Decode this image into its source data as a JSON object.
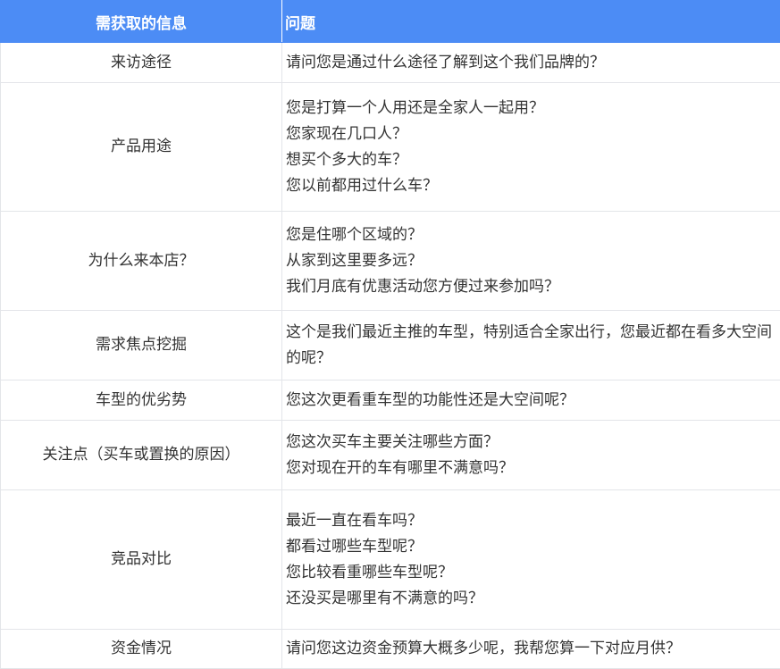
{
  "header": {
    "col1": "需获取的信息",
    "col2": "问题"
  },
  "rows": [
    {
      "info": "来访途径",
      "questions": [
        "请问您是通过什么途径了解到这个我们品牌的？"
      ]
    },
    {
      "info": "产品用途",
      "questions": [
        "您是打算一个人用还是全家人一起用？",
        "您家现在几口人？",
        "想买个多大的车？",
        "您以前都用过什么车？"
      ]
    },
    {
      "info": "为什么来本店？",
      "questions": [
        "您是住哪个区域的？",
        "从家到这里要多远？",
        "我们月底有优惠活动您方便过来参加吗？"
      ]
    },
    {
      "info": "需求焦点挖掘",
      "questions": [
        "这个是我们最近主推的车型，特别适合全家出行，您最近都在看多大空间的呢？"
      ]
    },
    {
      "info": "车型的优劣势",
      "questions": [
        "您这次更看重车型的功能性还是大空间呢？"
      ]
    },
    {
      "info": "关注点（买车或置换的原因）",
      "questions": [
        "您这次买车主要关注哪些方面？",
        "您对现在开的车有哪里不满意吗？"
      ]
    },
    {
      "info": "竞品对比",
      "questions": [
        "最近一直在看车吗？",
        "都看过哪些车型呢？",
        "您比较看重哪些车型呢？",
        "还没买是哪里有不满意的吗？"
      ]
    },
    {
      "info": "资金情况",
      "questions": [
        "请问您这边资金预算大概多少呢，我帮您算一下对应月供？"
      ]
    }
  ]
}
